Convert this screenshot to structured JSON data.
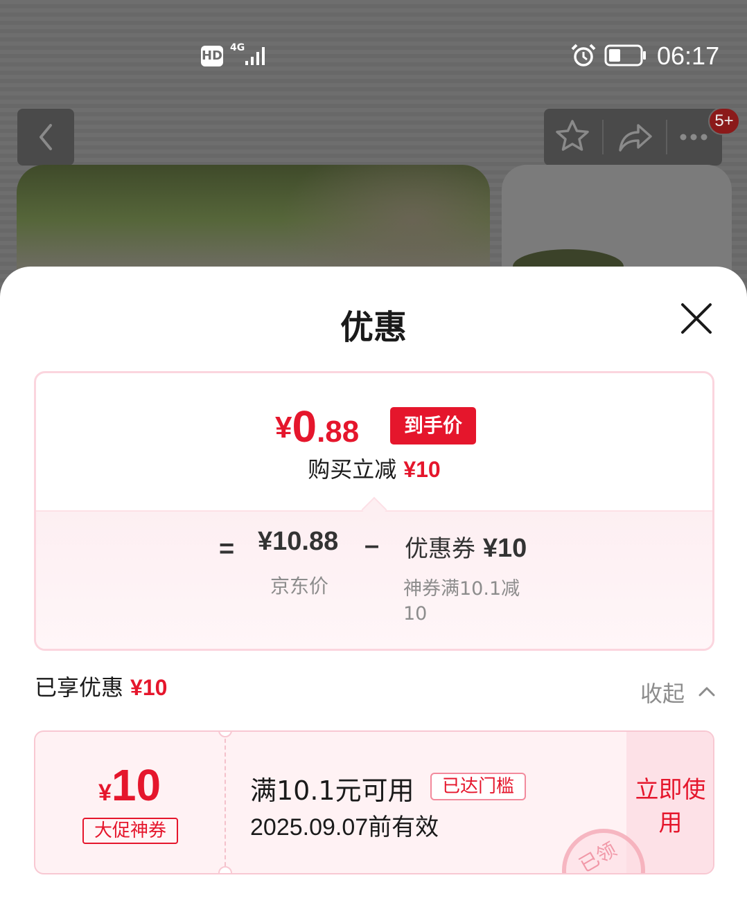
{
  "status_bar": {
    "hd_label": "HD",
    "network_label": "4G",
    "time": "06:17",
    "icons": [
      "signal-icon",
      "alarm-icon",
      "battery-icon"
    ]
  },
  "nav": {
    "icons": [
      "back-icon",
      "star-icon",
      "share-icon",
      "more-icon"
    ],
    "badge": "5+"
  },
  "sheet": {
    "title": "优惠",
    "close_icon": "close-icon"
  },
  "price_summary": {
    "currency": "¥",
    "final_price_int": "0",
    "final_price_dec": ".88",
    "final_tag": "到手价",
    "reduce_label": "购买立减",
    "reduce_amount": "¥10",
    "equals": "=",
    "jd_price": "¥10.88",
    "jd_label": "京东价",
    "minus": "–",
    "coupon_label": "优惠券",
    "coupon_amount": "¥10",
    "coupon_desc": "神券满10.1减10"
  },
  "enjoyed": {
    "label": "已享优惠",
    "amount": "¥10",
    "collapse_label": "收起",
    "collapse_icon": "chevron-up-icon"
  },
  "coupon": {
    "currency": "¥",
    "value": "10",
    "type": "大促神券",
    "condition": "满10.1元可用",
    "reached_badge": "已达门槛",
    "valid_until": "2025.09.07前有效",
    "use_button": "立即使用",
    "stamp_text": "已领"
  },
  "colors": {
    "accent": "#e5162c",
    "card_border": "#fbd5de",
    "coupon_bg": "#fff2f4"
  }
}
